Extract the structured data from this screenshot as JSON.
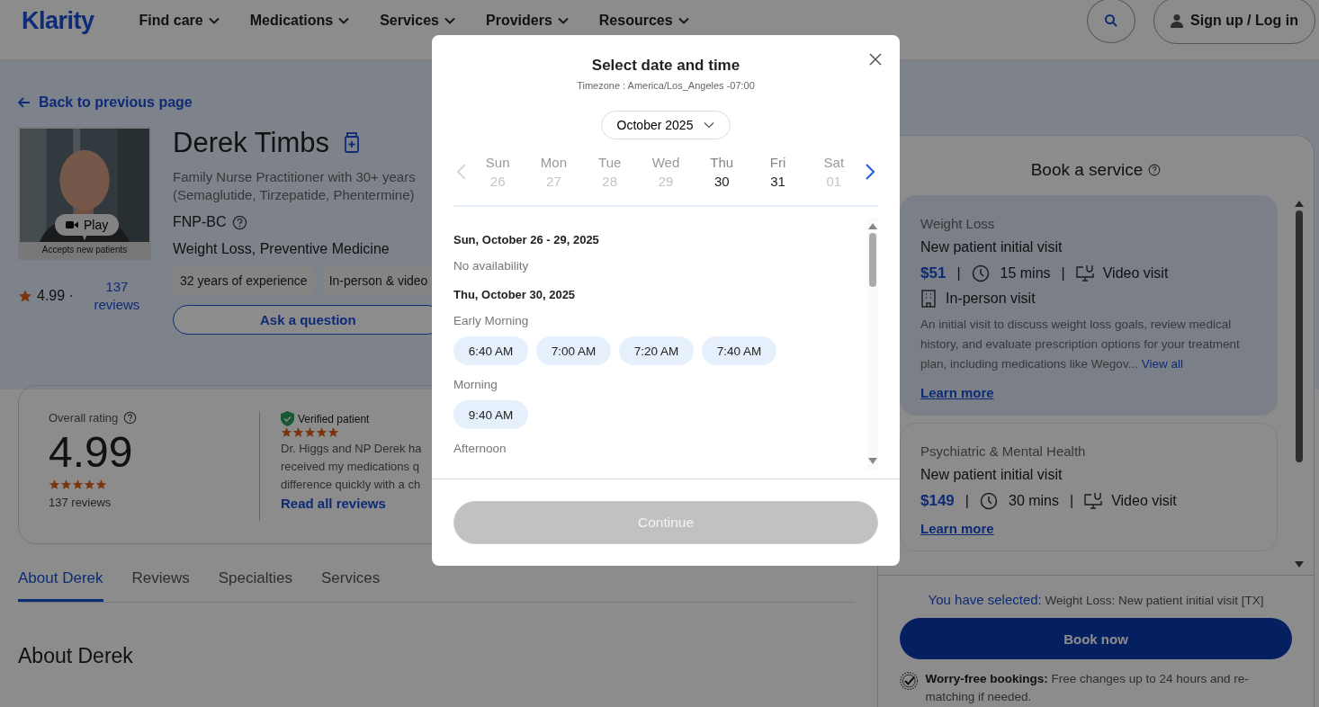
{
  "header": {
    "logo": "Klarity",
    "nav": [
      {
        "label": "Find care"
      },
      {
        "label": "Medications"
      },
      {
        "label": "Services"
      },
      {
        "label": "Providers"
      },
      {
        "label": "Resources"
      }
    ],
    "login": "Sign up / Log in"
  },
  "back_link": "Back to previous page",
  "profile": {
    "name": "Derek Timbs",
    "title_lines": [
      "Family Nurse Practitioner with 30+ years",
      "(Semaglutide, Tirzepatide, Phentermine)"
    ],
    "credential": "FNP-BC",
    "specialties": "Weight Loss, Preventive Medicine",
    "chips": [
      "32 years of experience",
      "In-person & video"
    ],
    "play": "Play",
    "accepts": "Accepts new patients",
    "rating": "4.99 ·",
    "reviews_link": "137 reviews",
    "ask_button": "Ask a question"
  },
  "rating_card": {
    "label": "Overall rating",
    "score": "4.99",
    "stars": 5,
    "count": "137 reviews",
    "review": {
      "verified": "Verified patient",
      "stars": 5,
      "lines": [
        "Dr. Higgs and NP Derek ha",
        "received my medications q",
        "difference quickly with a ch"
      ],
      "read_all": "Read all reviews"
    }
  },
  "tabs": [
    {
      "label": "About Derek",
      "selected": true
    },
    {
      "label": "Reviews",
      "selected": false
    },
    {
      "label": "Specialties",
      "selected": false
    },
    {
      "label": "Services",
      "selected": false
    }
  ],
  "about_heading": "About Derek",
  "booking": {
    "title": "Book a service",
    "services": [
      {
        "category": "Weight Loss",
        "name": "New patient initial visit",
        "price": "$51",
        "separator": "|",
        "duration": "15 mins",
        "visits": [
          {
            "kind": "video",
            "label": "Video visit"
          },
          {
            "kind": "in_person",
            "label": "In-person visit"
          }
        ],
        "description": "An initial visit to discuss weight loss goals, review medical history, and evaluate prescription options for your treatment plan, including medications like Wegov...",
        "view_all": "View all",
        "learn_more": "Learn more",
        "selected": true
      },
      {
        "category": "Psychiatric & Mental Health",
        "name": "New patient initial visit",
        "price": "$149",
        "separator": "|",
        "duration": "30 mins",
        "visits": [
          {
            "kind": "video",
            "label": "Video visit"
          }
        ],
        "learn_more": "Learn more",
        "selected": false
      }
    ],
    "selected_label": "You have selected:",
    "selected_value": "Weight Loss: New patient initial visit [TX]",
    "book_button": "Book now",
    "worry_bold": "Worry-free bookings:",
    "worry_text": "Free changes up to 24 hours and re-matching if needed."
  },
  "modal": {
    "title": "Select date and time",
    "timezone": "Timezone : America/Los_Angeles -07:00",
    "month": "October 2025",
    "days": [
      {
        "weekday": "Sun",
        "date": "26",
        "available": false,
        "selected": false
      },
      {
        "weekday": "Mon",
        "date": "27",
        "available": false,
        "selected": false
      },
      {
        "weekday": "Tue",
        "date": "28",
        "available": false,
        "selected": false
      },
      {
        "weekday": "Wed",
        "date": "29",
        "available": false,
        "selected": false
      },
      {
        "weekday": "Thu",
        "date": "30",
        "available": true,
        "selected": false
      },
      {
        "weekday": "Fri",
        "date": "31",
        "available": true,
        "selected": false
      },
      {
        "weekday": "Sat",
        "date": "01",
        "available": false,
        "selected": false
      }
    ],
    "sections": [
      {
        "heading": "Sun, October 26 - 29, 2025",
        "note": "No availability"
      },
      {
        "heading": "Thu, October 30, 2025",
        "groups": [
          {
            "label": "Early Morning",
            "slots": [
              {
                "time": "6:40 AM",
                "selected": false
              },
              {
                "time": "7:00 AM",
                "selected": false
              },
              {
                "time": "7:20 AM",
                "selected": false
              },
              {
                "time": "7:40 AM",
                "selected": false
              }
            ]
          },
          {
            "label": "Morning",
            "slots": [
              {
                "time": "9:40 AM",
                "selected": false
              }
            ]
          },
          {
            "label": "Afternoon"
          }
        ]
      }
    ],
    "continue": {
      "label": "Continue",
      "disabled": true
    }
  }
}
